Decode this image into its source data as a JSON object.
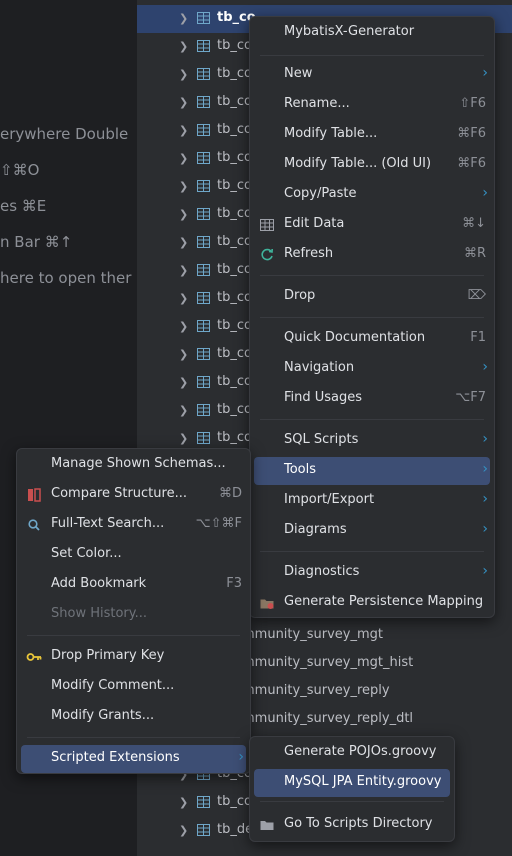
{
  "editor_hints": [
    "erywhere  Double",
    " ⇧⌘O",
    "es  ⌘E",
    "n Bar  ⌘↑",
    "here to open ther"
  ],
  "tree": {
    "tables": [
      "tb_co",
      "tb_co",
      "tb_co",
      "tb_co",
      "tb_co",
      "tb_co",
      "tb_co",
      "tb_co",
      "tb_co",
      "tb_co",
      "tb_co",
      "tb_co",
      "tb_co",
      "tb_co",
      "tb_co",
      "tb_co"
    ],
    "middle_rows": [
      "mmunity_survey_mgt",
      "mmunity_survey_mgt_hist",
      "mmunity_survey_reply",
      "mmunity_survey_reply_dtl"
    ],
    "bottom_rows": [
      "tb_co",
      "tb_co",
      "tb_de"
    ]
  },
  "main_menu": {
    "title": "MybatisX-Generator",
    "items": {
      "new": {
        "label": "New"
      },
      "rename": {
        "label": "Rename...",
        "shortcut": "⇧F6"
      },
      "modify_table": {
        "label": "Modify Table...",
        "shortcut": "⌘F6"
      },
      "modify_table_old": {
        "label": "Modify Table... (Old UI)",
        "shortcut": "⌘F6"
      },
      "copy_paste": {
        "label": "Copy/Paste"
      },
      "edit_data": {
        "label": "Edit Data",
        "shortcut": "⌘↓"
      },
      "refresh": {
        "label": "Refresh",
        "shortcut": "⌘R"
      },
      "drop": {
        "label": "Drop",
        "shortcut": "⌦"
      },
      "quick_doc": {
        "label": "Quick Documentation",
        "shortcut": "F1"
      },
      "navigation": {
        "label": "Navigation"
      },
      "find_usages": {
        "label": "Find Usages",
        "shortcut": "⌥F7"
      },
      "sql_scripts": {
        "label": "SQL Scripts"
      },
      "tools": {
        "label": "Tools"
      },
      "import_export": {
        "label": "Import/Export"
      },
      "diagrams": {
        "label": "Diagrams"
      },
      "diagnostics": {
        "label": "Diagnostics"
      },
      "gen_persistence": {
        "label": "Generate Persistence Mapping"
      }
    }
  },
  "tools_menu": {
    "manage_schemas": {
      "label": "Manage Shown Schemas..."
    },
    "compare_structure": {
      "label": "Compare Structure...",
      "shortcut": "⌘D"
    },
    "full_text_search": {
      "label": "Full-Text Search...",
      "shortcut": "⌥⇧⌘F"
    },
    "set_color": {
      "label": "Set Color..."
    },
    "add_bookmark": {
      "label": "Add Bookmark",
      "shortcut": "F3"
    },
    "show_history": {
      "label": "Show History..."
    },
    "drop_pk": {
      "label": "Drop Primary Key"
    },
    "modify_comment": {
      "label": "Modify Comment..."
    },
    "modify_grants": {
      "label": "Modify Grants..."
    },
    "scripted_ext": {
      "label": "Scripted Extensions"
    }
  },
  "scripts_menu": {
    "gen_pojos": {
      "label": "Generate POJOs.groovy"
    },
    "mysql_jpa": {
      "label": "MySQL JPA Entity.groovy"
    },
    "go_to_dir": {
      "label": "Go To Scripts Directory"
    }
  },
  "colors": {
    "accent": "#3592c4",
    "highlight": "#3d4e74",
    "selection": "#2e436e",
    "background": "#2b2d30"
  }
}
